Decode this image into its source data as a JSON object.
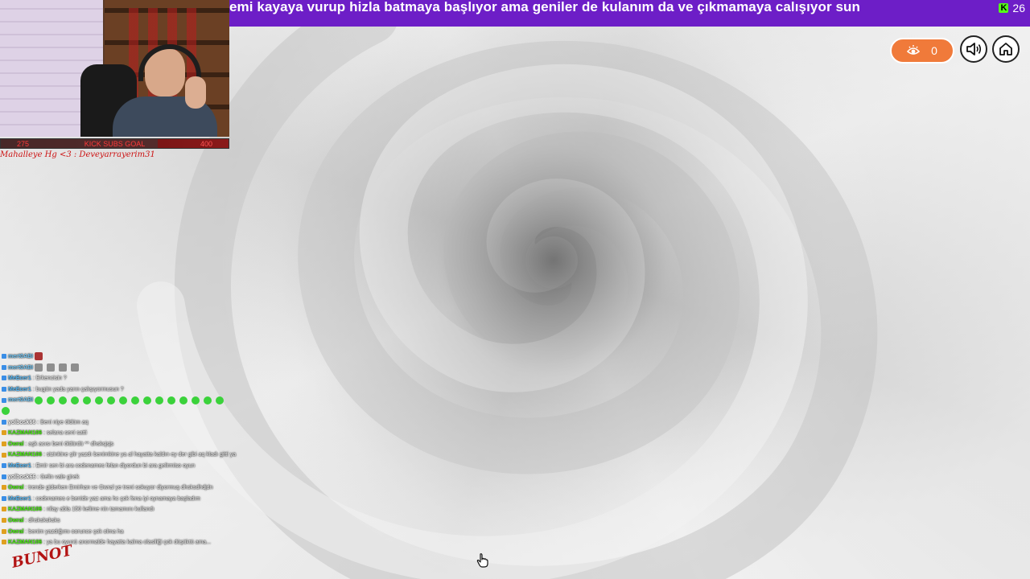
{
  "banner": {
    "scrolling_text": "emi kayaya vurup hizla batmaya başlıyor ama geniler de kulanım da ve çıkmamaya calışıyor sun",
    "viewer_count": "26",
    "platform_icon": "kick-icon"
  },
  "stream_overlay": {
    "goal_left": "275",
    "goal_center": "KICK SUBS GOAL",
    "goal_right": "400",
    "goal_progress": 0.69,
    "signature": "Mahalleye Hg <3 : Deveyarrayerim31"
  },
  "game_controls": {
    "eye_count": "0",
    "sound_icon": "speaker-icon",
    "home_icon": "home-icon"
  },
  "chat": [
    {
      "user": "mert0ABI",
      "msg": "",
      "color": "#7ad0ff",
      "emotes": [
        "red"
      ]
    },
    {
      "user": "mert0ABI",
      "msg": "",
      "color": "#7ad0ff",
      "emotes": [
        "grey",
        "grey",
        "grey",
        "grey"
      ]
    },
    {
      "user": "MeEcer1",
      "msg": ": Erkencisin ?",
      "color": "#5bc0ff",
      "emotes": []
    },
    {
      "user": "MeEcer1",
      "msg": ": bugün yada yarın çalışıyormusun ?",
      "color": "#5bc0ff",
      "emotes": []
    },
    {
      "user": "mert0ABI",
      "msg": "",
      "color": "#7ad0ff",
      "emotes": [
        "green",
        "green",
        "green",
        "green",
        "green",
        "green",
        "green",
        "green",
        "green",
        "green",
        "green",
        "green",
        "green",
        "green",
        "green",
        "green"
      ]
    },
    {
      "user": "",
      "msg": "",
      "color": "#7ad0ff",
      "emotes": [
        "green"
      ]
    },
    {
      "user": "yolbosk66",
      "msg": ": Beni niye öldüm aq",
      "color": "#ffffff",
      "emotes": []
    },
    {
      "user": "KAZMAN106",
      "msg": ": selana seni satti",
      "color": "#53fc18",
      "emotes": []
    },
    {
      "user": "Owral",
      "msg": ": aşk acısı beni öldürdü ** dhsksjsjs",
      "color": "#53fc18",
      "emotes": []
    },
    {
      "user": "KAZMAN106",
      "msg": ": sizinkine şiir yazdı benimkine ya al hayatta kaldın ey der gibi aq kladı gitti ya",
      "color": "#53fc18",
      "emotes": []
    },
    {
      "user": "MeEcer1",
      "msg": ": Emir sen bi ara codenames felan diyordun bi ara gelirmiso oyun",
      "color": "#5bc0ff",
      "emotes": []
    },
    {
      "user": "yolbosk66",
      "msg": ": Gelin vale girek",
      "color": "#ffffff",
      "emotes": []
    },
    {
      "user": "Owral",
      "msg": ": trende giderken Emirhan ve Owral ye treni sokuyor diyormuş dhsksdhdjdn",
      "color": "#53fc18",
      "emotes": []
    },
    {
      "user": "MeEcer1",
      "msg": ": codenames e benide yaz ama hc çok fena iyi oynamaya başladım",
      "color": "#5bc0ff",
      "emotes": []
    },
    {
      "user": "KAZMAN106",
      "msg": ": nilay abla 150 kelime nin tamamını kullandı",
      "color": "#53fc18",
      "emotes": []
    },
    {
      "user": "Owral",
      "msg": ": dhsksksksks",
      "color": "#53fc18",
      "emotes": []
    },
    {
      "user": "Owral",
      "msg": ": benim yazdığımı oorunce çok olma ha",
      "color": "#53fc18",
      "emotes": []
    },
    {
      "user": "KAZMAN106",
      "msg": ": ya bu oyunü anormalde hayatta kalma olasiliği çok düşüktü ama...",
      "color": "#53fc18",
      "emotes": []
    }
  ],
  "logo": "BUNOT"
}
